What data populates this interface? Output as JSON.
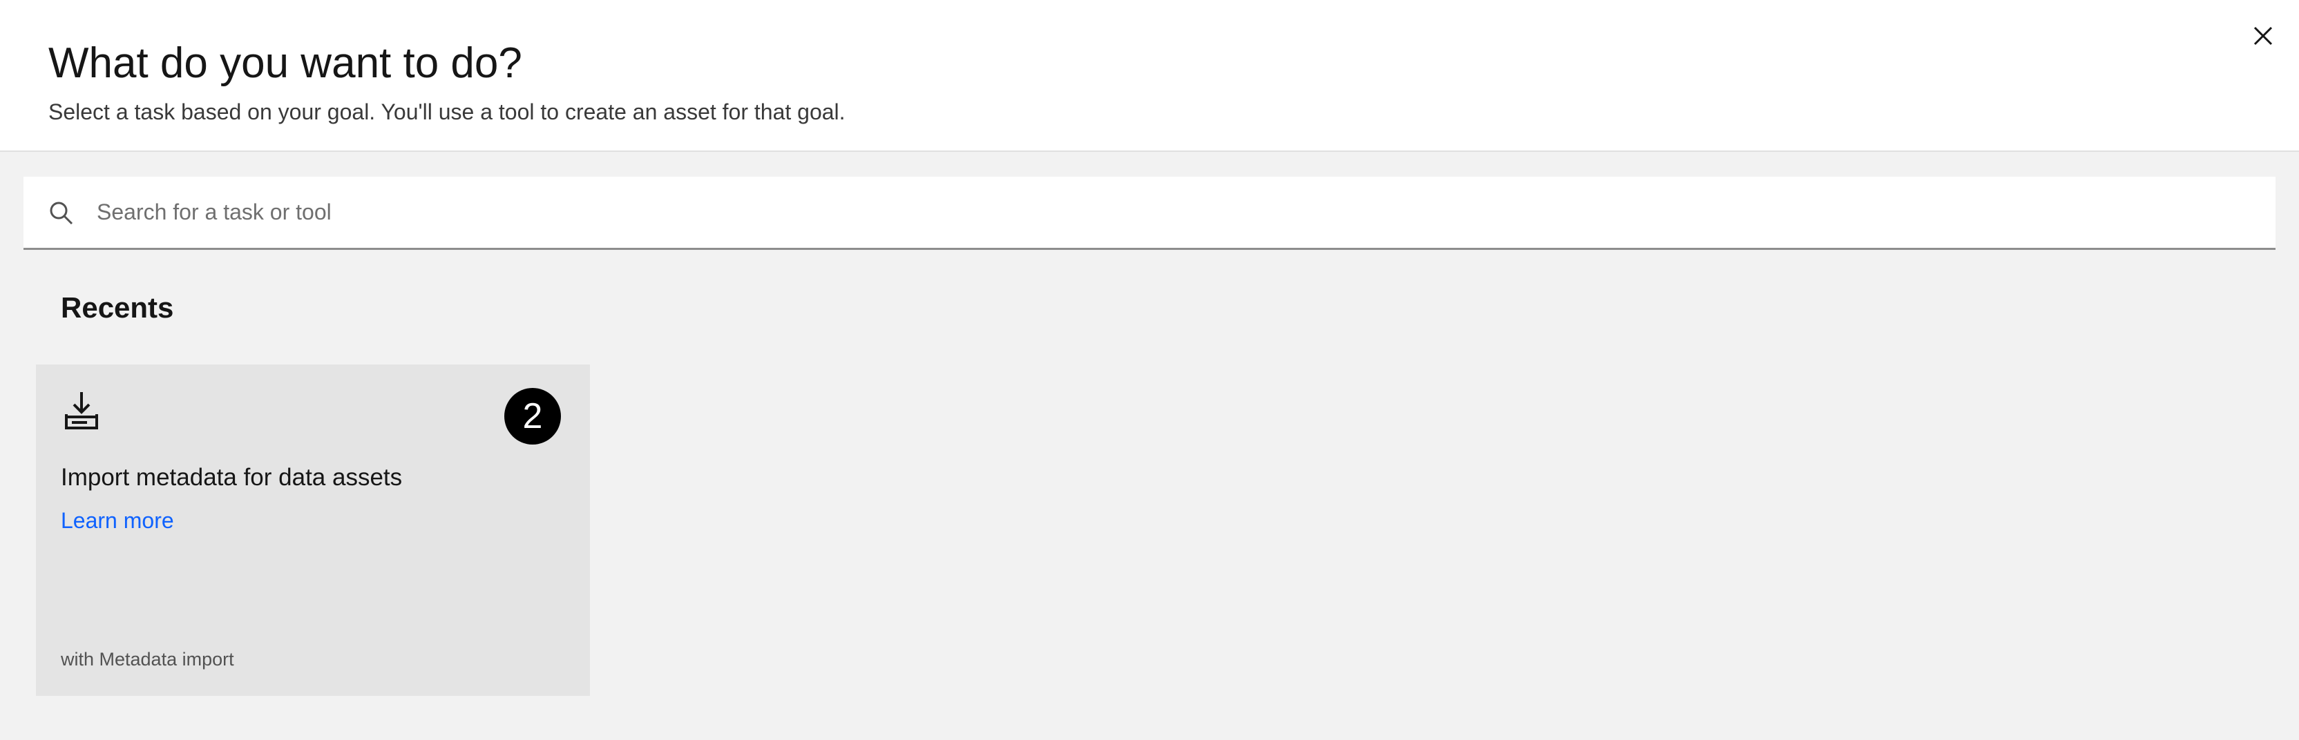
{
  "header": {
    "title": "What do you want to do?",
    "subtitle": "Select a task based on your goal. You'll use a tool to create an asset for that goal.",
    "close_icon": "close-icon"
  },
  "search": {
    "placeholder": "Search for a task or tool",
    "value": "",
    "icon": "search-icon"
  },
  "recents": {
    "title": "Recents",
    "items": [
      {
        "icon": "download-icon",
        "badge": "2",
        "title": "Import metadata for data assets",
        "link_label": "Learn more",
        "tool_label": "with Metadata import"
      }
    ]
  },
  "colors": {
    "page_background": "#f2f2f2",
    "header_background": "#ffffff",
    "tile_background": "#e4e4e4",
    "link": "#0f62fe",
    "badge_background": "#000000"
  }
}
